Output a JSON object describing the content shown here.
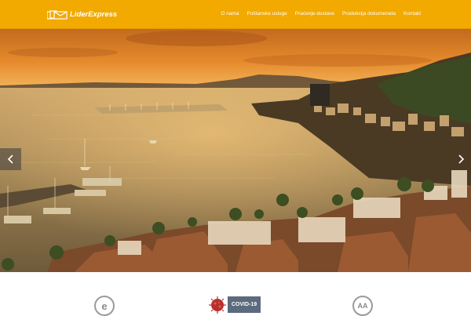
{
  "brand": {
    "name": "LiderExpress",
    "logo_icon": "envelope-stack-icon"
  },
  "nav": {
    "items": [
      {
        "label": "O nama"
      },
      {
        "label": "Poštanske usluge"
      },
      {
        "label": "Praćenje dostave"
      },
      {
        "label": "Produkcija dokumenata"
      },
      {
        "label": "Kontakt"
      }
    ]
  },
  "hero": {
    "slider_prev_icon": "chevron-left-icon",
    "slider_next_icon": "chevron-right-icon"
  },
  "features": {
    "items": [
      {
        "icon": "e-circle-icon",
        "glyph": "e"
      },
      {
        "icon": "covid-virus-icon",
        "label": "COVID-19"
      },
      {
        "icon": "aa-circle-icon",
        "glyph": "AA"
      }
    ]
  },
  "colors": {
    "header_bg": "#f2a900",
    "nav_text": "#ffffff",
    "icon_gray": "#9a9a9a",
    "covid_banner": "#5c6a7e"
  }
}
